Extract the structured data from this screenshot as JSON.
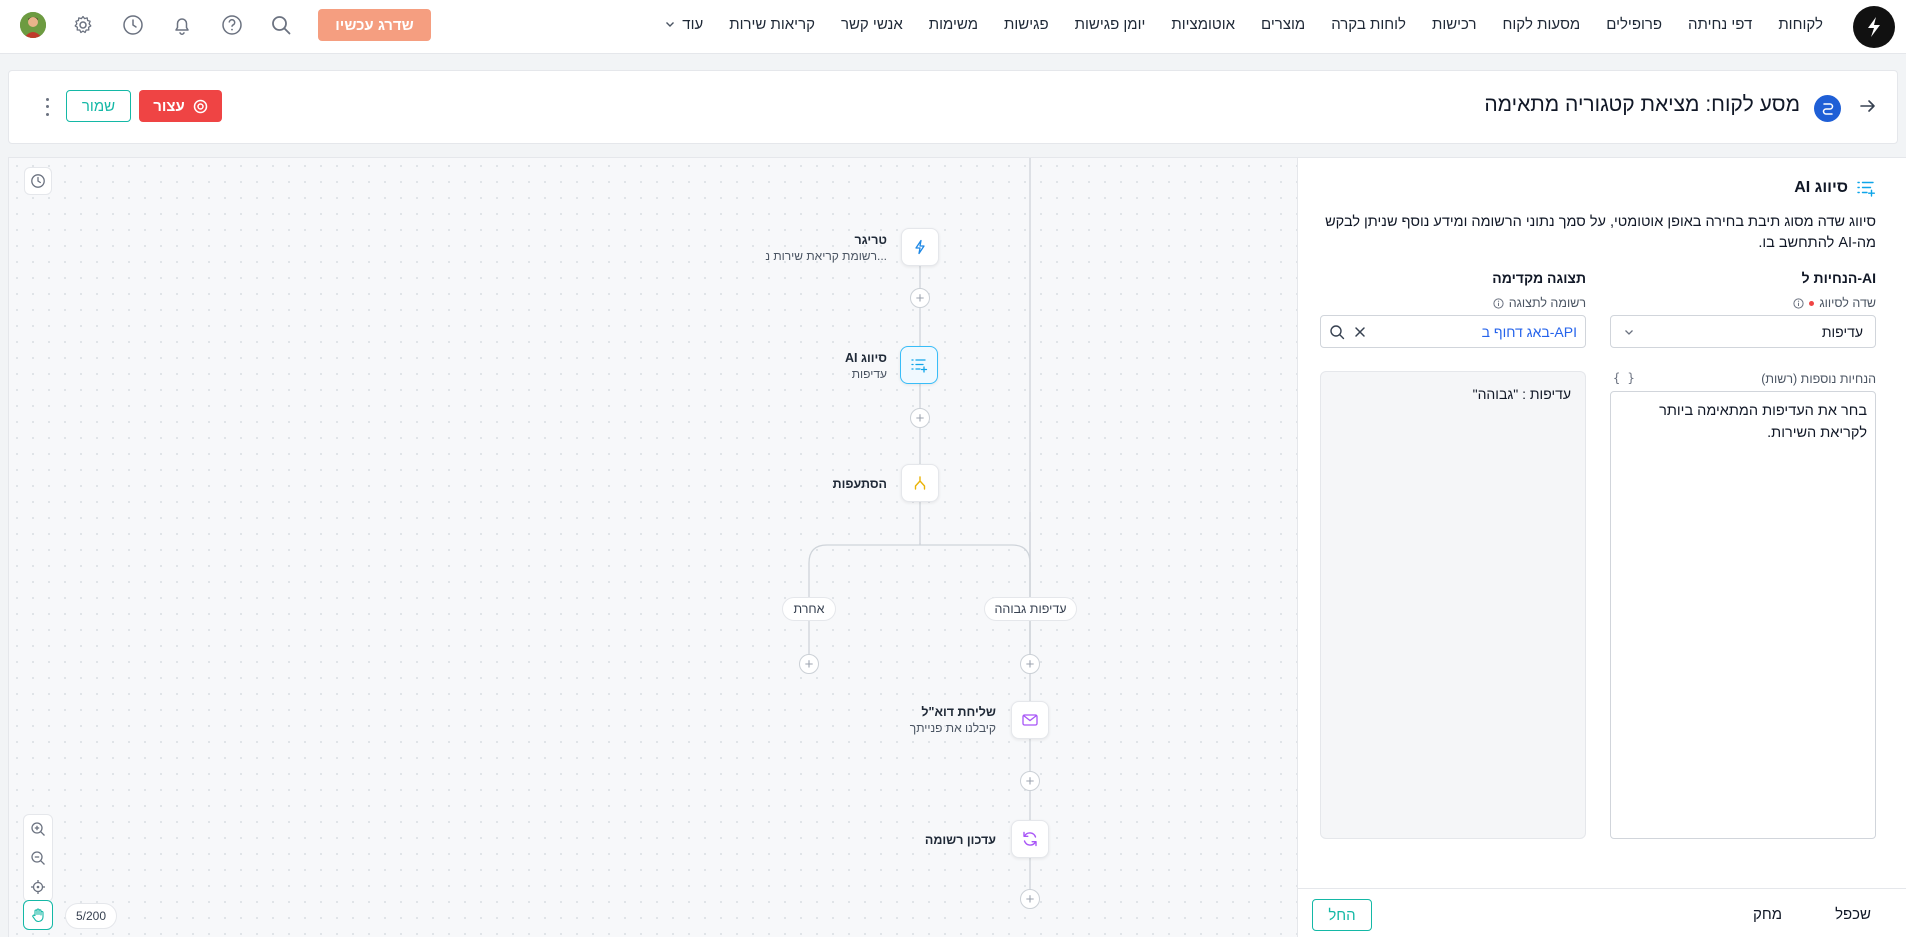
{
  "nav": {
    "items": [
      "לקוחות",
      "דפי נחיתה",
      "פרופילים",
      "מסעות לקוח",
      "רכישות",
      "לוחות בקרה",
      "מוצרים",
      "אוטומציות",
      "יומן פגישות",
      "פגישות",
      "משימות",
      "אנשי קשר",
      "קריאות שירות"
    ],
    "more_label": "עוד",
    "upgrade_label": "שדרג עכשיו",
    "icons": [
      "search-icon",
      "help-icon",
      "bell-icon",
      "history-icon",
      "settings-icon",
      "avatar"
    ]
  },
  "header": {
    "title": "מסע לקוח: מציאת קטגוריה מתאימה",
    "stop_label": "עצור",
    "save_label": "שמור"
  },
  "flow": {
    "trigger": {
      "title": "טריגר",
      "subtitle": "רשומת קריאת שירות נ..."
    },
    "ai_classify": {
      "title": "AI סיווג",
      "subtitle": "עדיפות"
    },
    "branches": {
      "title": "הסתעפות",
      "branch_high": "עדיפות גבוהה",
      "branch_other": "אחרת"
    },
    "send_email": {
      "title": "שליחת דוא\"ל",
      "subtitle": "קיבלנו את פנייתך"
    },
    "update_record": {
      "title": "עדכון רשומה"
    },
    "counter": "5/200"
  },
  "panel": {
    "title": "AI סיווג",
    "description": "סיווג שדה מסוג תיבת בחירה באופן אוטומטי, על סמך נתוני הרשומה ומידע נוסף שניתן לבקש מה-AI להתחשב בו.",
    "ai_instructions_heading": "הנחיות ל-AI",
    "preview_heading": "תצוגה מקדימה",
    "field_label": "שדה לסיווג",
    "field_value": "עדיפות",
    "record_label": "רשומה לתצוגה",
    "record_value": "באג דחוף ב-API",
    "extra_label": "הנחיות נוספות (רשות)",
    "braces": "{ }",
    "extra_value": "בחר את העדיפות המתאימה ביותר לקריאת השירות.",
    "preview_text": "עדיפות : \"גבוהה\"",
    "footer": {
      "duplicate": "שכפל",
      "delete": "מחק",
      "apply": "החל"
    }
  },
  "colors": {
    "accent": "#14b8a6",
    "danger": "#ef4444",
    "upgrade": "#f59e80",
    "link": "#2563eb",
    "selected": "#38bdf8"
  }
}
